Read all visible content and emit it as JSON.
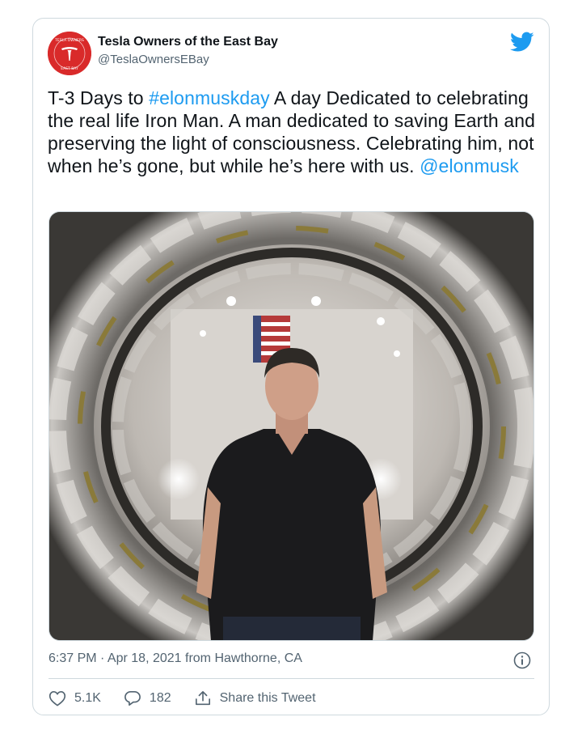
{
  "account": {
    "display_name": "Tesla Owners of the East Bay",
    "handle": "@TeslaOwnersEBay",
    "avatar_text_top": "TESLA OWNERS",
    "avatar_text_bottom": "EAST BAY"
  },
  "tweet": {
    "text_part1": "T-3 Days to ",
    "hashtag": "#elonmuskday",
    "text_part2": " A day Dedicated to celebrating the real life Iron Man. A man dedicated to saving Earth and preserving the light of consciousness. Celebrating him, not when he’s gone, but while he’s here with us. ",
    "mention": "@elonmusk"
  },
  "meta": {
    "timestamp": "6:37 PM · Apr 18, 2021 from Hawthorne, CA"
  },
  "actions": {
    "likes": "5.1K",
    "replies": "182",
    "share_label": "Share this Tweet"
  },
  "colors": {
    "link": "#1d9bf0",
    "secondary_text": "#536471",
    "border": "#cfd9de",
    "avatar_bg": "#d92a2a"
  },
  "icons": [
    "twitter-bird-icon",
    "info-icon",
    "heart-icon",
    "reply-icon",
    "share-icon"
  ]
}
